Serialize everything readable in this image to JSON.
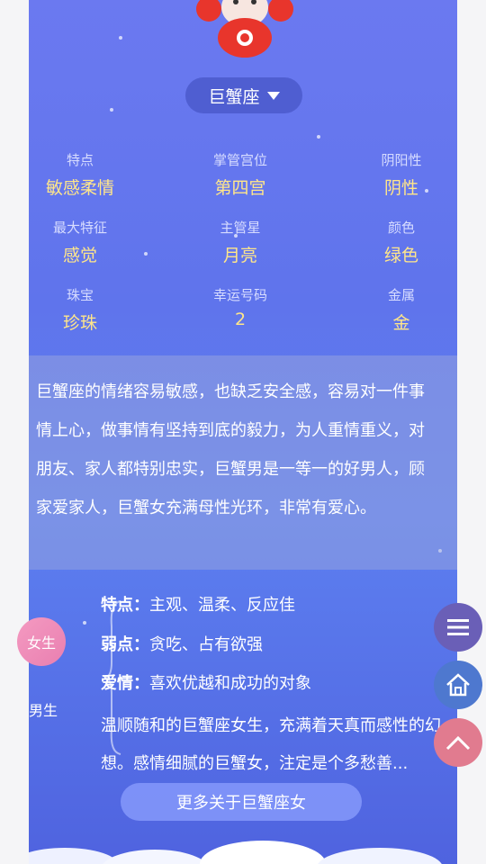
{
  "sign_selector": {
    "label": "巨蟹座"
  },
  "attributes": [
    {
      "key": "特点",
      "value": "敏感柔情"
    },
    {
      "key": "掌管宫位",
      "value": "第四宫"
    },
    {
      "key": "阴阳性",
      "value": "阴性"
    },
    {
      "key": "最大特征",
      "value": "感觉"
    },
    {
      "key": "主管星",
      "value": "月亮"
    },
    {
      "key": "颜色",
      "value": "绿色"
    },
    {
      "key": "珠宝",
      "value": "珍珠"
    },
    {
      "key": "幸运号码",
      "value": "2"
    },
    {
      "key": "金属",
      "value": "金"
    }
  ],
  "description": "巨蟹座的情绪容易敏感，也缺乏安全感，容易对一件事情上心，做事情有坚持到底的毅力，为人重情重义，对朋友、家人都特别忠实，巨蟹男是一等一的好男人，顾家爱家人，巨蟹女充满母性光环，非常有爱心。",
  "gender_tabs": {
    "female": "女生",
    "male": "男生"
  },
  "traits": {
    "features_label": "特点：",
    "features": "主观、温柔、反应佳",
    "weakness_label": "弱点：",
    "weakness": "贪吃、占有欲强",
    "love_label": "爱情：",
    "love": "喜欢优越和成功的对象",
    "summary": "温顺随和的巨蟹座女生，充满着天真而感性的幻想。感情细腻的巨蟹女，注定是个多愁善..."
  },
  "more_button": "更多关于巨蟹座女"
}
